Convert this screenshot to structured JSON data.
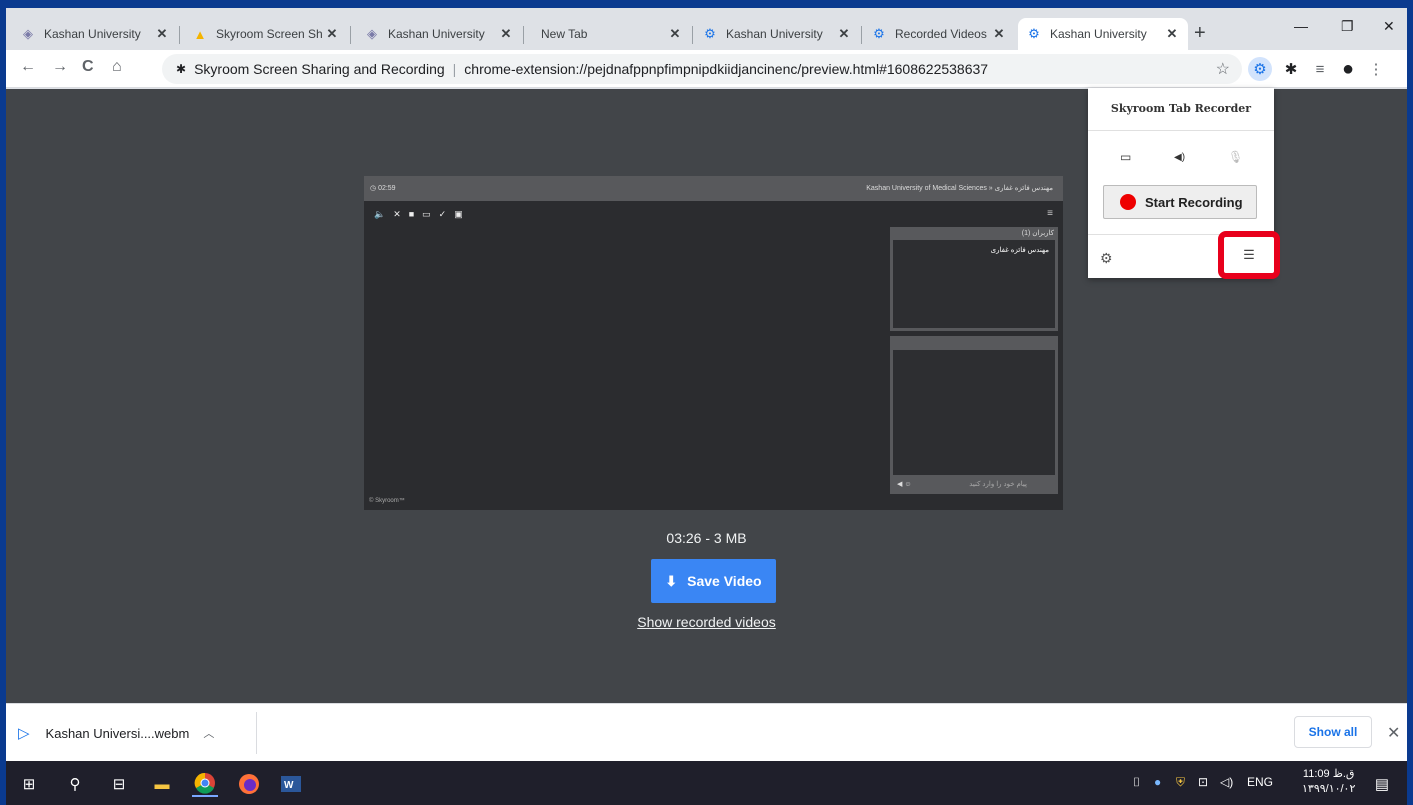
{
  "tabs": [
    {
      "title": "Kashan University",
      "icon": "skyroom-diamond-icon"
    },
    {
      "title": "Skyroom Screen Sh",
      "icon": "drive-icon"
    },
    {
      "title": "Kashan University",
      "icon": "skyroom-diamond-icon"
    },
    {
      "title": "New Tab",
      "icon": ""
    },
    {
      "title": "Kashan University",
      "icon": "recorder-ext-icon"
    },
    {
      "title": "Recorded Videos",
      "icon": "recorder-ext-icon"
    },
    {
      "title": "Kashan University",
      "icon": "recorder-ext-icon",
      "active": true
    }
  ],
  "toolbar": {
    "site_name": "Skyroom Screen Sharing and Recording",
    "url": "chrome-extension://pejdnafppnpfimpnipdkiidjancinenc/preview.html#1608622538637"
  },
  "video": {
    "clock": "02:59",
    "room_title": "Kashan University of Medical Sciences » مهندس فائزه غفاری",
    "users_header": "کاربران (1)",
    "user_name": "مهندس فائزه غفاری",
    "chat_placeholder": "پیام خود را وارد کنید",
    "footer": "© Skyroom™"
  },
  "preview": {
    "meta": "03:26 - 3 MB",
    "save_label": "Save Video",
    "show_link": "Show recorded videos"
  },
  "popup": {
    "title": "Skyroom Tab Recorder",
    "start_label": "Start Recording",
    "highlight_color": "#e8001c"
  },
  "shelf": {
    "file": "Kashan Universi....webm",
    "show_all": "Show all"
  },
  "taskbar": {
    "lang": "ENG",
    "time": "11:09 ق.ظ",
    "date": "۱۳۹۹/۱۰/۰۲"
  },
  "colors": {
    "accent": "#3a86f4",
    "page_bg": "#424549",
    "record": "#ee0000"
  }
}
